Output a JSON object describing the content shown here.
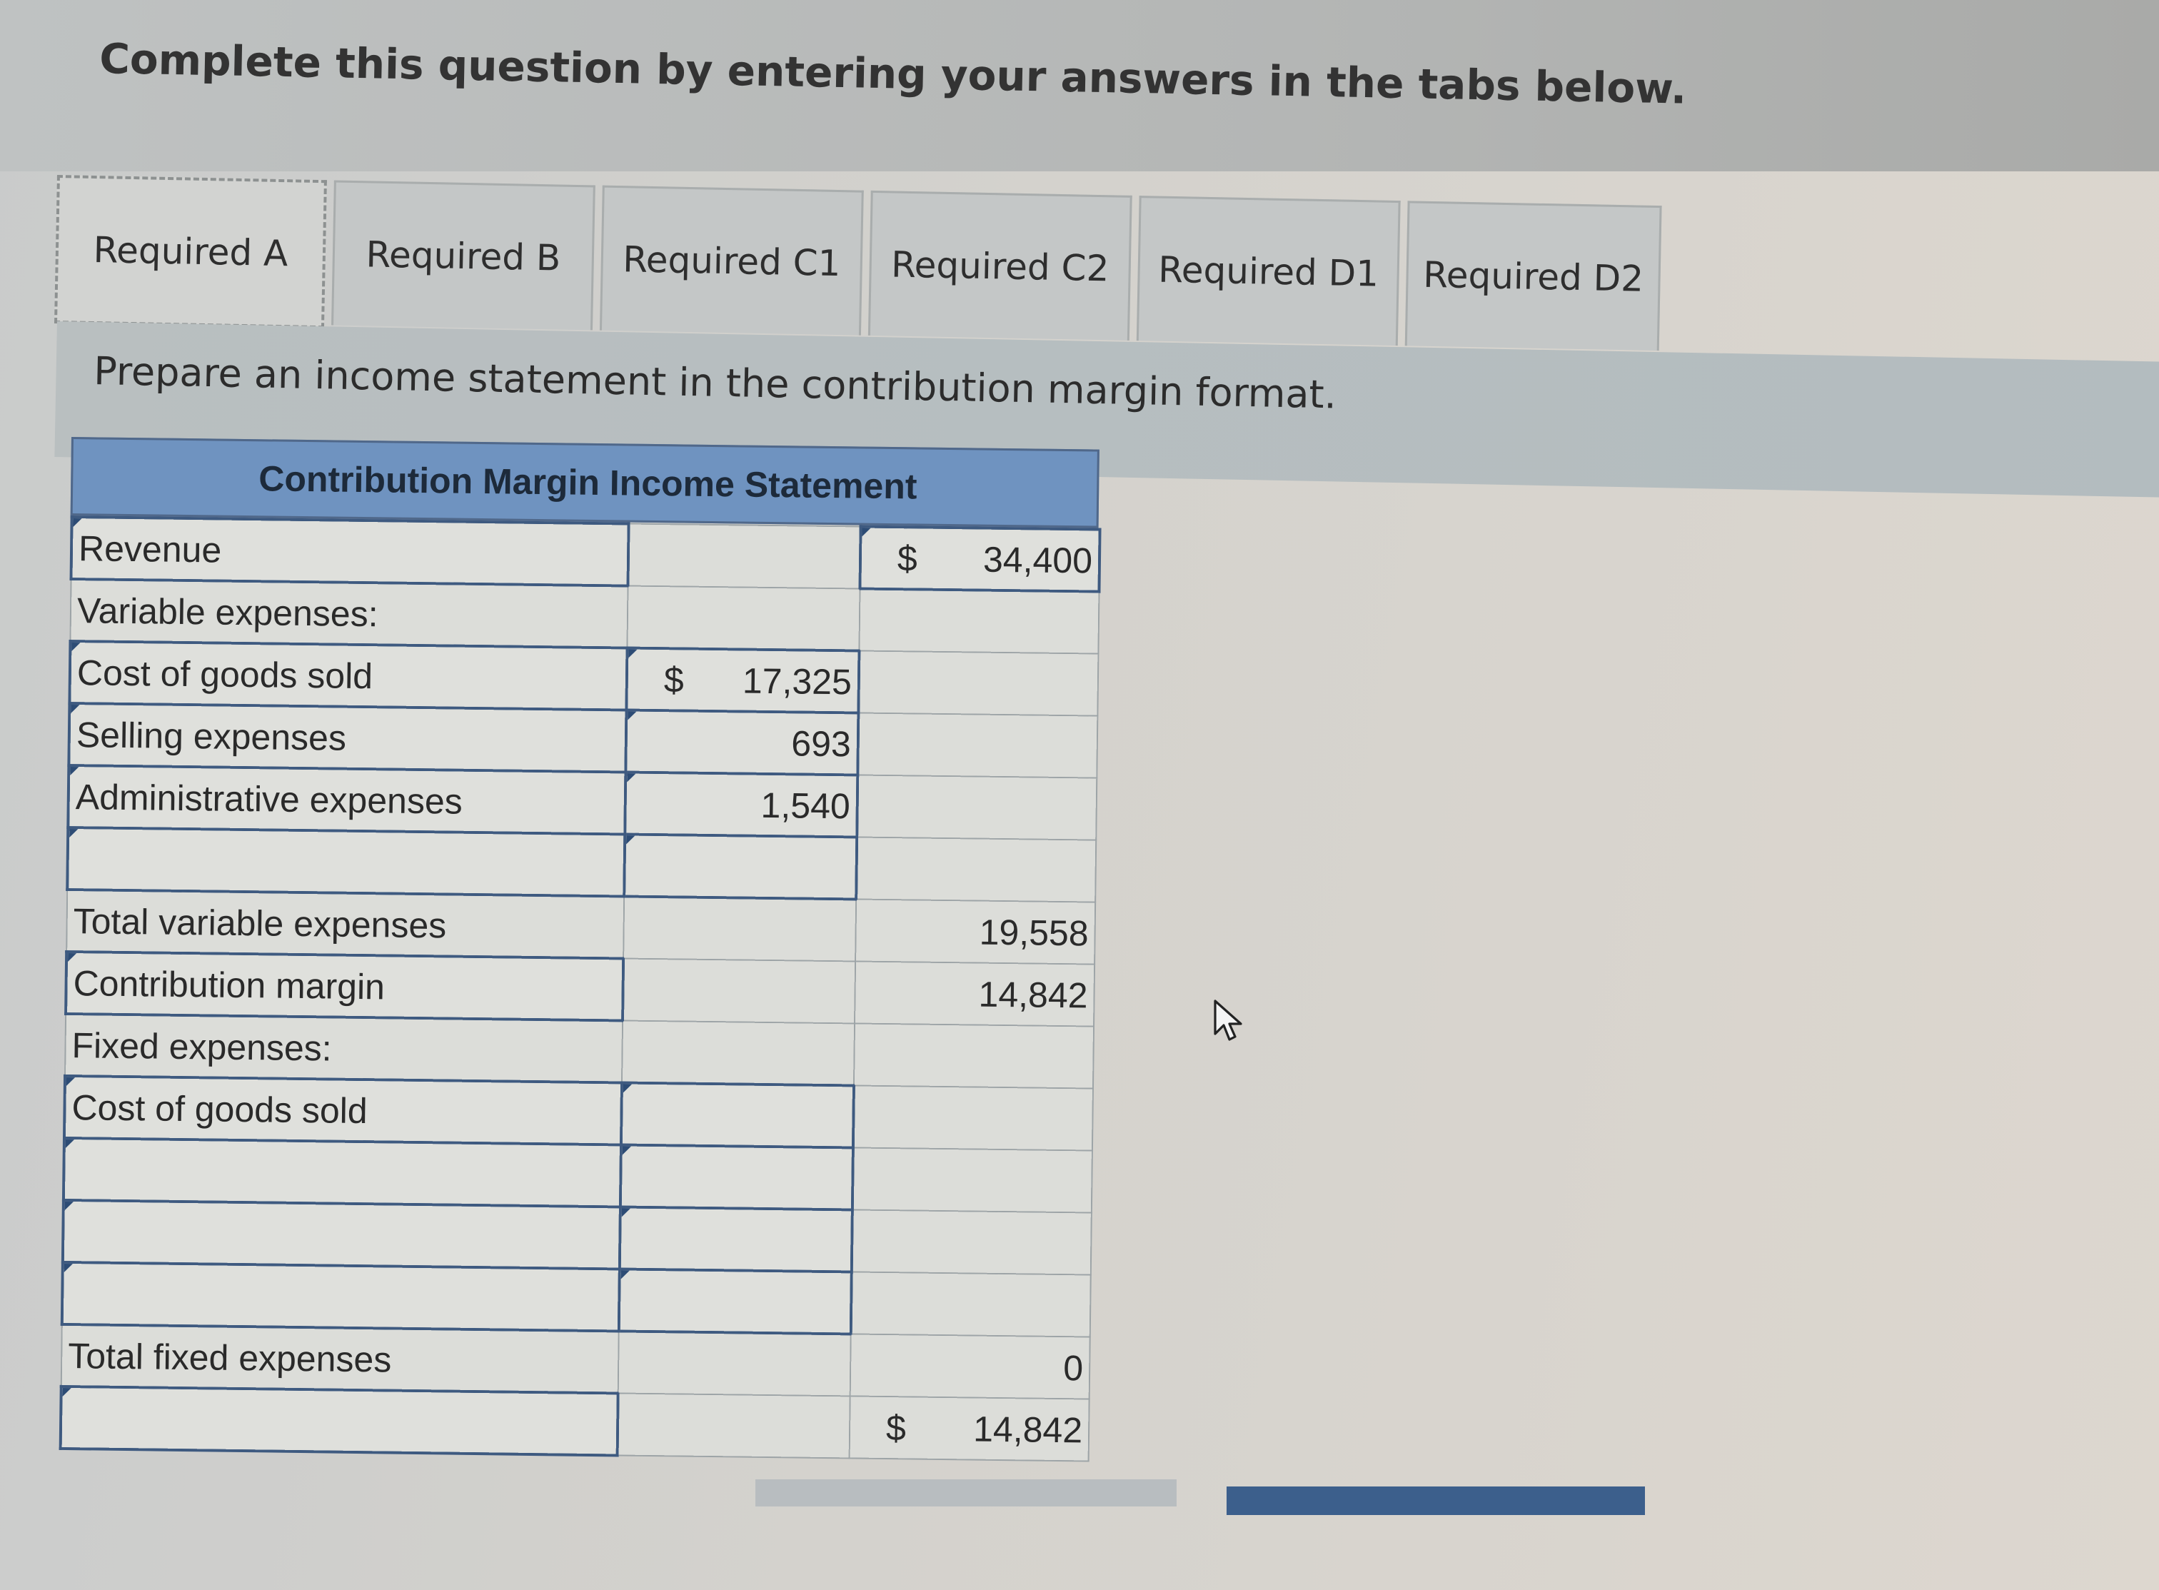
{
  "header": {
    "title": "Complete this question by entering your answers in the tabs below."
  },
  "tabs": [
    {
      "label": "Required A",
      "active": true
    },
    {
      "label": "Required B",
      "active": false
    },
    {
      "label": "Required C1",
      "active": false
    },
    {
      "label": "Required C2",
      "active": false
    },
    {
      "label": "Required D1",
      "active": false
    },
    {
      "label": "Required D2",
      "active": false
    }
  ],
  "instructions": "Prepare an income statement in the contribution margin format.",
  "statement": {
    "title": "Contribution Margin Income Statement",
    "rows": [
      {
        "label": "Revenue",
        "col1": "",
        "col2": "34,400",
        "col2_dollar": "$"
      },
      {
        "label": "Variable expenses:",
        "col1": "",
        "col2": ""
      },
      {
        "label": "Cost of goods sold",
        "col1": "17,325",
        "col1_dollar": "$",
        "col2": ""
      },
      {
        "label": "Selling expenses",
        "col1": "693",
        "col2": ""
      },
      {
        "label": "Administrative expenses",
        "col1": "1,540",
        "col2": ""
      },
      {
        "label": "",
        "col1": "",
        "col2": ""
      },
      {
        "label": "Total variable expenses",
        "col1": "",
        "col2": "19,558"
      },
      {
        "label": "Contribution margin",
        "col1": "",
        "col2": "14,842"
      },
      {
        "label": "Fixed expenses:",
        "col1": "",
        "col2": ""
      },
      {
        "label": "Cost of goods sold",
        "col1": "",
        "col2": ""
      },
      {
        "label": "",
        "col1": "",
        "col2": ""
      },
      {
        "label": "",
        "col1": "",
        "col2": ""
      },
      {
        "label": "",
        "col1": "",
        "col2": ""
      },
      {
        "label": "Total fixed expenses",
        "col1": "",
        "col2": "0"
      },
      {
        "label": "",
        "col1": "",
        "col2": "14,842",
        "col2_dollar": "$"
      }
    ]
  },
  "icons": {
    "cursor": "mouse-pointer-icon"
  },
  "colors": {
    "table_header": "#6f93c0",
    "input_border": "#3e5a80",
    "primary_button": "#3c5f8c"
  }
}
